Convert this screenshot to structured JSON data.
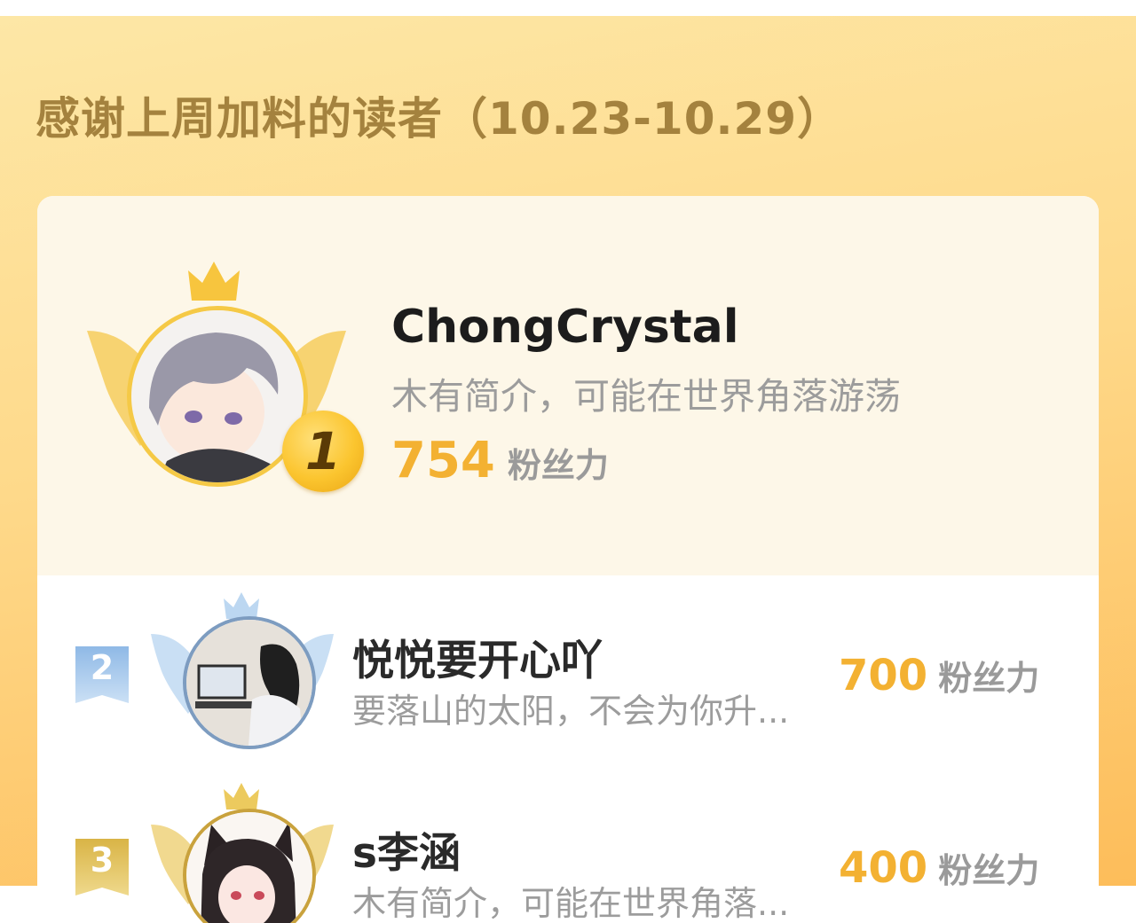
{
  "page": {
    "title": "感谢上周加料的读者（10.23-10.29）"
  },
  "colors": {
    "accent_gold": "#f3b132",
    "title_color": "#a4823e",
    "silver": "#a8c8e8",
    "bronze": "#e2c25a"
  },
  "leaderboard": {
    "score_unit": "粉丝力",
    "entries": [
      {
        "rank": "1",
        "name": "ChongCrystal",
        "bio": "木有简介，可能在世界角落游荡",
        "score": "754"
      },
      {
        "rank": "2",
        "name": "悦悦要开心吖",
        "bio": "要落山的太阳，不会为你升...",
        "score": "700"
      },
      {
        "rank": "3",
        "name": "s李涵",
        "bio": "木有简介，可能在世界角落...",
        "score": "400"
      }
    ]
  },
  "icons": [
    "crown-icon",
    "wings-icon",
    "rank-badge-icon",
    "avatar-image"
  ]
}
